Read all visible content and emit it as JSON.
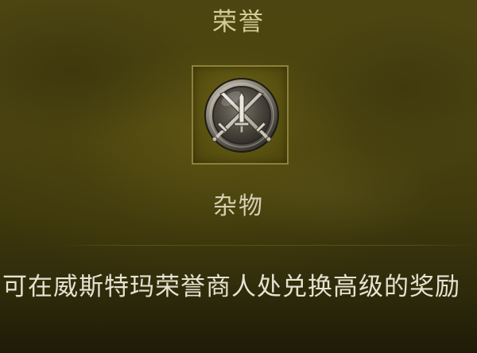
{
  "item": {
    "name": "荣誉",
    "icon": "crossed-swords-medal-icon",
    "category": "杂物",
    "description": "可在威斯特玛荣誉商人处兑换高级的奖励"
  },
  "colors": {
    "title_text": "#d6cd96",
    "category_text": "#d5cfb3",
    "description_text": "#e6e2d2",
    "frame_border": "#8d8238",
    "background": "#4a4310"
  }
}
